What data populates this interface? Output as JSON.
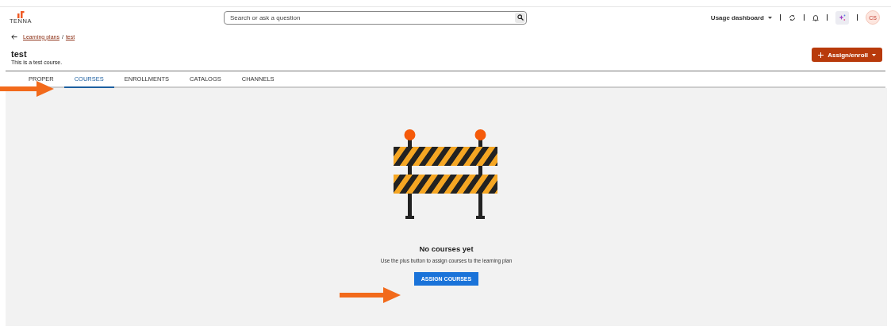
{
  "header": {
    "logo_text": "TENNA",
    "search": {
      "placeholder": "Search or ask a question"
    },
    "dashboard_menu": "Usage dashboard",
    "avatar": "CS"
  },
  "breadcrumb": [
    "Learning plans",
    "/",
    "test"
  ],
  "page": {
    "title": "test",
    "subtitle": "This is a test course.",
    "action_button": "Assign/enroll"
  },
  "tabs": [
    {
      "label": "PROPER",
      "selected": false
    },
    {
      "label": "COURSES",
      "selected": true
    },
    {
      "label": "ENROLLMENTS",
      "selected": false
    },
    {
      "label": "CATALOGS",
      "selected": false
    },
    {
      "label": "CHANNELS",
      "selected": false
    }
  ],
  "empty_state": {
    "title": "No courses yet",
    "message": "Use the plus button to assign courses to the learning plan",
    "button": "ASSIGN COURSES"
  }
}
